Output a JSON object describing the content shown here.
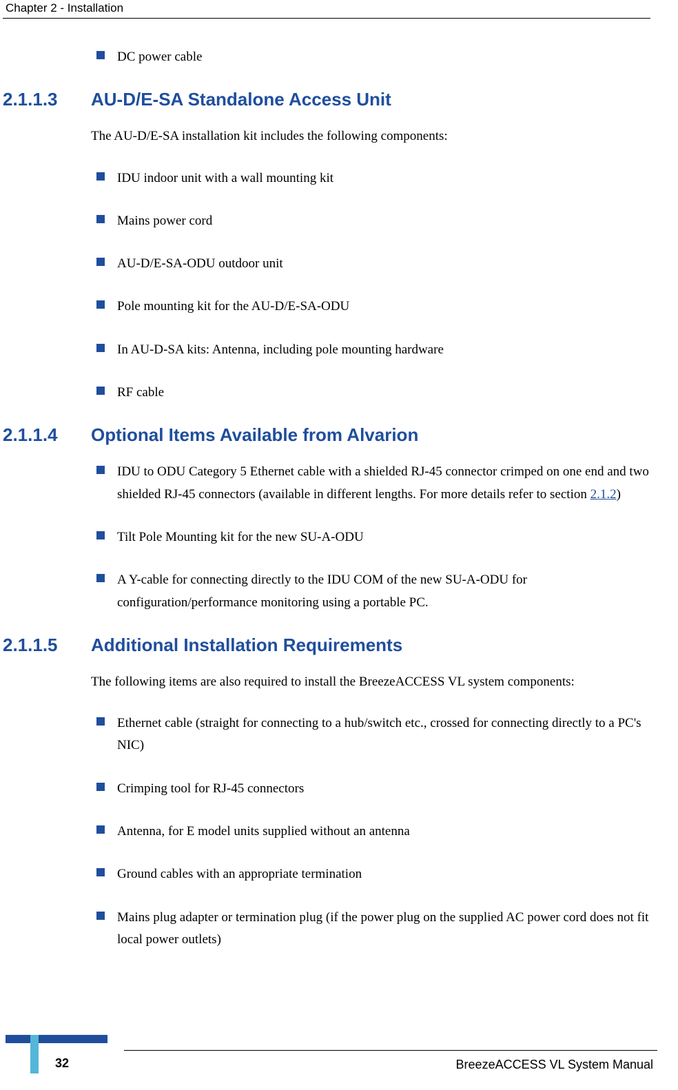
{
  "header": {
    "text": "Chapter 2 - Installation"
  },
  "sections": [
    {
      "pre_bullets": [
        "DC power cable"
      ]
    },
    {
      "number": "2.1.1.3",
      "title": "AU-D/E-SA Standalone Access Unit",
      "intro": "The AU-D/E-SA installation kit includes the following components:",
      "bullets": [
        "IDU indoor unit with a wall mounting kit",
        "Mains power cord",
        "AU-D/E-SA-ODU outdoor unit",
        "Pole mounting kit for the AU-D/E-SA-ODU",
        "In AU-D-SA kits: Antenna, including pole mounting hardware",
        "RF cable"
      ]
    },
    {
      "number": "2.1.1.4",
      "title": "Optional Items Available from Alvarion",
      "bullets_rich": [
        {
          "pre": "IDU to ODU Category 5 Ethernet cable with a shielded RJ-45 connector crimped on one end and two shielded RJ-45 connectors (available in different lengths. For more details refer to section ",
          "link": "2.1.2",
          "post": ")"
        },
        {
          "text": "Tilt Pole Mounting kit for the new SU-A-ODU"
        },
        {
          "text": "A Y-cable for connecting directly to the IDU COM of the new SU-A-ODU for configuration/performance monitoring using a portable PC."
        }
      ]
    },
    {
      "number": "2.1.1.5",
      "title": "Additional Installation Requirements",
      "intro": "The following items are also required to install the BreezeACCESS VL system components:",
      "bullets": [
        "Ethernet cable (straight for connecting to a hub/switch etc., crossed for connecting directly to a PC's NIC)",
        "Crimping tool for RJ-45 connectors",
        "Antenna, for E model units supplied without an antenna",
        "Ground cables with an appropriate termination",
        "Mains plug adapter or termination plug (if the power plug on the supplied AC power cord does not fit local power outlets)"
      ]
    }
  ],
  "footer": {
    "page_number": "32",
    "manual_title": "BreezeACCESS VL System Manual"
  }
}
